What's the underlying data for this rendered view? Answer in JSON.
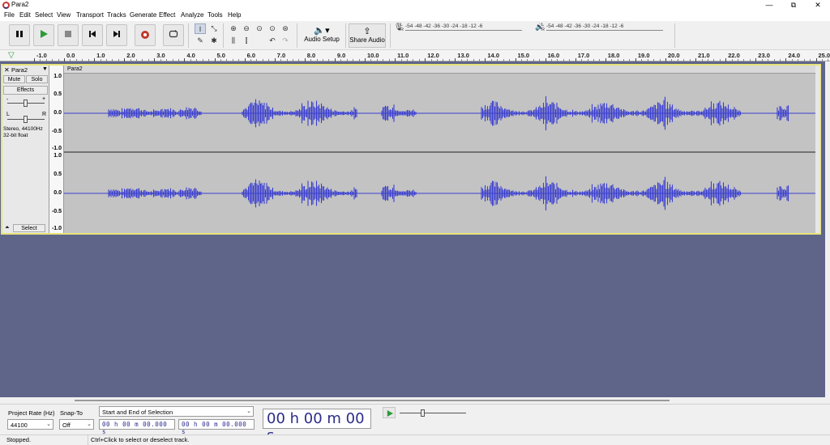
{
  "window": {
    "title": "Para2",
    "minimize": "—",
    "restore": "⧉",
    "close": "✕"
  },
  "menu": [
    "File",
    "Edit",
    "Select",
    "View",
    "Transport",
    "Tracks",
    "Generate",
    "Effect",
    "Analyze",
    "Tools",
    "Help"
  ],
  "toolbar": {
    "audio_setup": "Audio Setup",
    "share_audio": "Share Audio",
    "record_meter_scale": "-54  -48  -42  -36  -30  -24  -18  -12   -6",
    "play_meter_scale": "-54  -48  -42  -36  -30  -24  -18  -12   -6",
    "meter_l": "L",
    "meter_r": "R",
    "icons": {
      "pause": "pause-icon",
      "play": "play-icon",
      "stop": "stop-icon",
      "skip_start": "skip-to-start-icon",
      "skip_end": "skip-to-end-icon",
      "record": "record-icon",
      "loop": "loop-icon"
    }
  },
  "ruler": {
    "ticks": [
      "-1.0",
      "0.0",
      "1.0",
      "2.0",
      "3.0",
      "4.0",
      "5.0",
      "6.0",
      "7.0",
      "8.0",
      "9.0",
      "10.0",
      "11.0",
      "12.0",
      "13.0",
      "14.0",
      "15.0",
      "16.0",
      "17.0",
      "18.0",
      "19.0",
      "20.0",
      "21.0",
      "22.0",
      "23.0",
      "24.0",
      "25.0"
    ]
  },
  "track": {
    "name": "Para2",
    "clip_name": "Para2",
    "mute": "Mute",
    "solo": "Solo",
    "effects": "Effects",
    "pan_l": "L",
    "pan_r": "R",
    "info_line1": "Stereo, 44100Hz",
    "info_line2": "32-bit float",
    "select": "Select",
    "vruler": [
      "1.0",
      "0.5",
      "0.0",
      "-0.5",
      "-1.0"
    ]
  },
  "bottom": {
    "project_rate_label": "Project Rate (Hz)",
    "project_rate_value": "44100",
    "snap_to_label": "Snap-To",
    "snap_to_value": "Off",
    "selection_mode": "Start and End of Selection",
    "sel_start": "00 h 00 m 00.000 s",
    "sel_end": "00 h 00 m 00.000 s",
    "audio_position": "00 h 00 m 00 s"
  },
  "status": {
    "state": "Stopped.",
    "hint": "Ctrl+Click to select or deselect track."
  },
  "colors": {
    "waveform": "#3b3fd0",
    "workspace": "#5f6589",
    "track_border": "#e6e37a",
    "record": "#c0392b",
    "play": "#2e9a3a"
  }
}
